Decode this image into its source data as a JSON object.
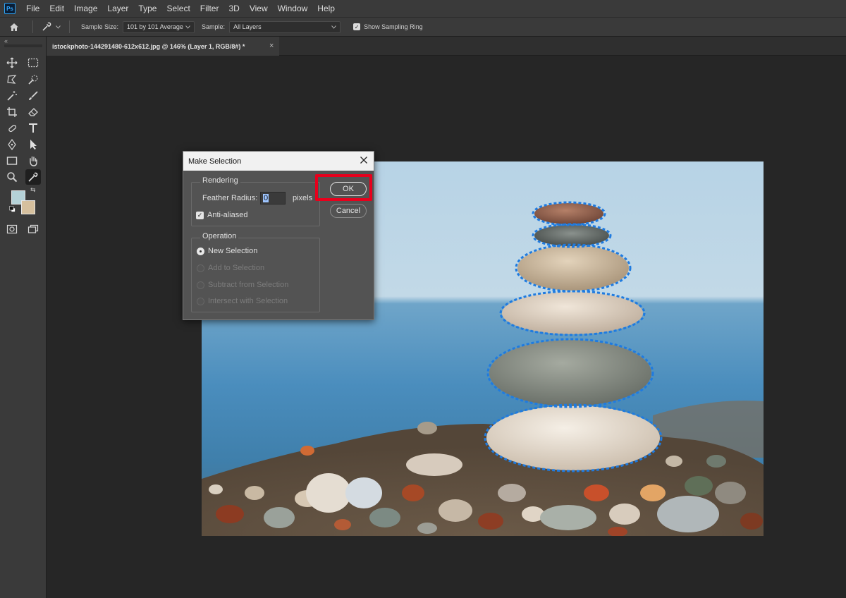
{
  "app": {
    "logo_text": "Ps",
    "menu": [
      "File",
      "Edit",
      "Image",
      "Layer",
      "Type",
      "Select",
      "Filter",
      "3D",
      "View",
      "Window",
      "Help"
    ]
  },
  "options": {
    "sample_size_label": "Sample Size:",
    "sample_size_value": "101 by 101 Average",
    "sample_label": "Sample:",
    "sample_value": "All Layers",
    "show_ring_label": "Show Sampling Ring",
    "show_ring_checked": true
  },
  "document": {
    "tab_title": "istockphoto-144291480-612x612.jpg @ 146% (Layer 1, RGB/8#) *"
  },
  "colors": {
    "foreground": "#b5d2d8",
    "background": "#d6c09e",
    "highlight": "#e8001c",
    "selection_marquee": "#1f7be0"
  },
  "dialog": {
    "title": "Make Selection",
    "rendering_legend": "Rendering",
    "feather_label": "Feather Radius:",
    "feather_value": "0",
    "feather_unit": "pixels",
    "anti_aliased_label": "Anti-aliased",
    "anti_aliased_checked": true,
    "operation_legend": "Operation",
    "operations": [
      {
        "label": "New Selection",
        "selected": true,
        "enabled": true
      },
      {
        "label": "Add to Selection",
        "selected": false,
        "enabled": false
      },
      {
        "label": "Subtract from Selection",
        "selected": false,
        "enabled": false
      },
      {
        "label": "Intersect with Selection",
        "selected": false,
        "enabled": false
      }
    ],
    "ok_label": "OK",
    "cancel_label": "Cancel"
  }
}
